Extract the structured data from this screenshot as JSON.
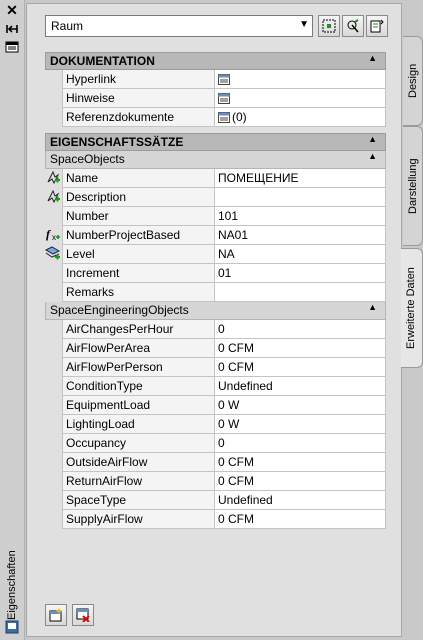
{
  "window": {
    "title": "Eigenschaften"
  },
  "toolbar": {
    "object_type": "Raum",
    "buttons": [
      "select-objects-icon",
      "quick-select-icon",
      "toggle-pickadd-icon"
    ]
  },
  "tabs": [
    {
      "label": "Design",
      "active": false
    },
    {
      "label": "Darstellung",
      "active": false
    },
    {
      "label": "Erweiterte Daten",
      "active": true
    }
  ],
  "dokumentation": {
    "title": "DOKUMENTATION",
    "rows": [
      {
        "name": "Hyperlink",
        "value": "",
        "icon": ""
      },
      {
        "name": "Hinweise",
        "value": "",
        "icon": ""
      },
      {
        "name": "Referenzdokumente",
        "value": "(0)",
        "icon": ""
      }
    ]
  },
  "eigenschaftssaetze": {
    "title": "EIGENSCHAFTSSÄTZE",
    "space_objects": {
      "title": "SpaceObjects",
      "rows": [
        {
          "name": "Name",
          "value": "ПОМЕЩЕНИЕ",
          "icon": "auto-property-icon"
        },
        {
          "name": "Description",
          "value": "",
          "icon": "auto-property-icon"
        },
        {
          "name": "Number",
          "value": "101",
          "icon": ""
        },
        {
          "name": "NumberProjectBased",
          "value": "NA01",
          "icon": "formula-icon"
        },
        {
          "name": "Level",
          "value": "NA",
          "icon": "level-property-icon"
        },
        {
          "name": "Increment",
          "value": "01",
          "icon": ""
        },
        {
          "name": "Remarks",
          "value": "",
          "icon": ""
        }
      ]
    },
    "space_engineering_objects": {
      "title": "SpaceEngineeringObjects",
      "rows": [
        {
          "name": "AirChangesPerHour",
          "value": "0"
        },
        {
          "name": "AirFlowPerArea",
          "value": "0 CFM"
        },
        {
          "name": "AirFlowPerPerson",
          "value": "0 CFM"
        },
        {
          "name": "ConditionType",
          "value": "Undefined"
        },
        {
          "name": "EquipmentLoad",
          "value": "0 W"
        },
        {
          "name": "LightingLoad",
          "value": "0 W"
        },
        {
          "name": "Occupancy",
          "value": "0"
        },
        {
          "name": "OutsideAirFlow",
          "value": "0 CFM"
        },
        {
          "name": "ReturnAirFlow",
          "value": "0 CFM"
        },
        {
          "name": "SpaceType",
          "value": "Undefined"
        },
        {
          "name": "SupplyAirFlow",
          "value": "0 CFM"
        }
      ]
    }
  },
  "bottom_buttons": [
    "add-property-sets-icon",
    "remove-property-sets-icon"
  ],
  "collapse_symbol": "▲"
}
